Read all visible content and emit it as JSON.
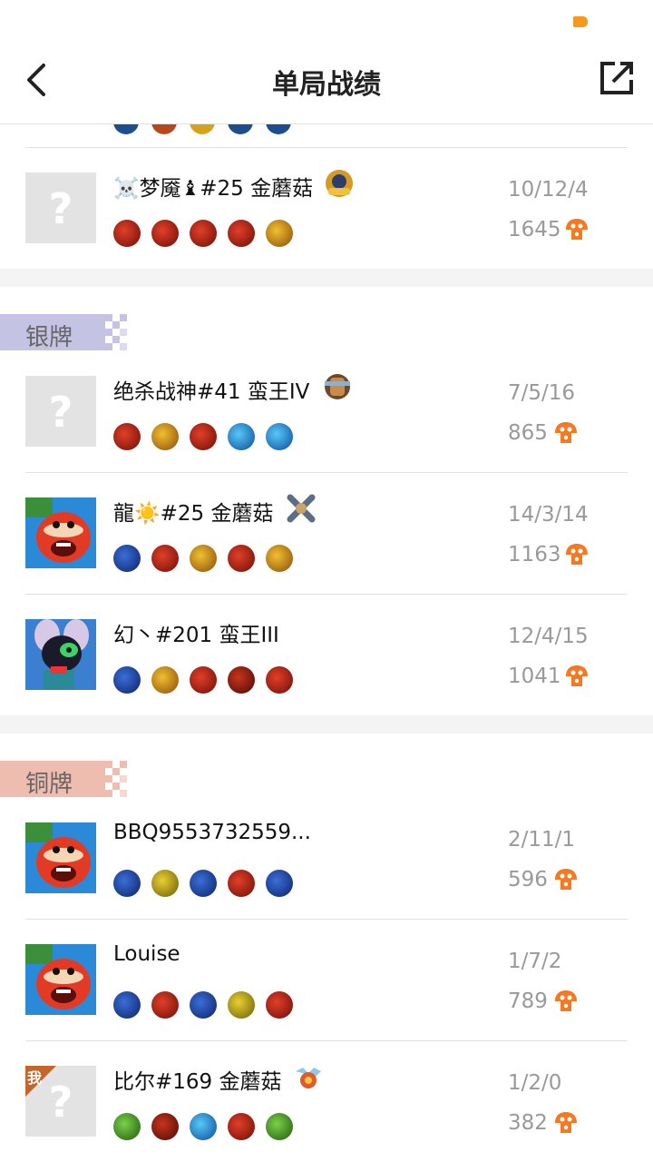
{
  "header": {
    "title": "单局战绩",
    "back_icon": "chevron-left-icon",
    "share_icon": "share-external-icon"
  },
  "colors": {
    "accent": "#f47920",
    "silver": "#c5c3e3",
    "bronze": "#efbcb0",
    "text_muted": "#999999"
  },
  "tiers": [
    {
      "label": "银牌"
    },
    {
      "label": "铜牌"
    }
  ],
  "players": [
    {
      "name": "☠️梦魇♝#25 金蘑菇",
      "kda": "10/12/4",
      "score": "1645",
      "avatar": "placeholder",
      "items": [
        "red",
        "red",
        "red",
        "red",
        "gold"
      ]
    },
    {
      "name": "绝杀战神#41 蛮王IV",
      "kda": "7/5/16",
      "score": "865",
      "avatar": "placeholder",
      "items": [
        "red",
        "gold",
        "red",
        "blue",
        "blue"
      ]
    },
    {
      "name": "龍☀️#25 金蘑菇",
      "kda": "14/3/14",
      "score": "1163",
      "avatar": "hero-orange",
      "items": [
        "magnet",
        "red",
        "gold",
        "red",
        "gold"
      ]
    },
    {
      "name": "幻丶#201 蛮王III",
      "kda": "12/4/15",
      "score": "1041",
      "avatar": "hero-purple",
      "items": [
        "magnet",
        "gold",
        "red",
        "red",
        "red"
      ]
    },
    {
      "name": "BBQ9553732559...",
      "kda": "2/11/1",
      "score": "596",
      "avatar": "hero-orange",
      "items": [
        "magnet",
        "yellow",
        "magnet",
        "red",
        "magnet"
      ]
    },
    {
      "name": "Louise",
      "kda": "1/7/2",
      "score": "789",
      "avatar": "hero-orange",
      "items": [
        "magnet",
        "red",
        "magnet",
        "yellow",
        "red"
      ]
    },
    {
      "name": "比尔#169 金蘑菇",
      "kda": "1/2/0",
      "score": "382",
      "avatar": "placeholder",
      "me_label": "我",
      "items": [
        "green",
        "red",
        "blue",
        "red",
        "green"
      ]
    }
  ]
}
